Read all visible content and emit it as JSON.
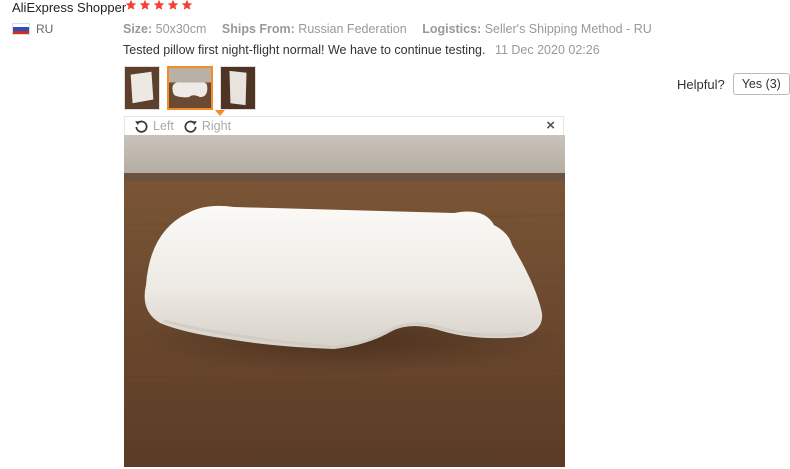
{
  "review": {
    "user_name": "AliExpress Shopper",
    "rating": 5,
    "country_code": "RU",
    "size_label": "Size:",
    "size_value": "50x30cm",
    "ships_label": "Ships From:",
    "ships_value": "Russian Federation",
    "logistics_label": "Logistics:",
    "logistics_value": "Seller's Shipping Method - RU",
    "text": "Tested pillow first night-flight normal! We have to continue testing.",
    "date": "11 Dec 2020 02:26",
    "thumbnail_count": 3,
    "selected_thumbnail": 2
  },
  "helpful": {
    "label": "Helpful?",
    "yes_button": "Yes (3)"
  },
  "viewer": {
    "rotate_left": "Left",
    "rotate_right": "Right",
    "close": "×"
  },
  "colors": {
    "star": "#f44336",
    "accent": "#f28b2b"
  },
  "icons": [
    "star-icon",
    "russia-flag-icon",
    "rotate-left-icon",
    "rotate-right-icon",
    "close-icon"
  ]
}
